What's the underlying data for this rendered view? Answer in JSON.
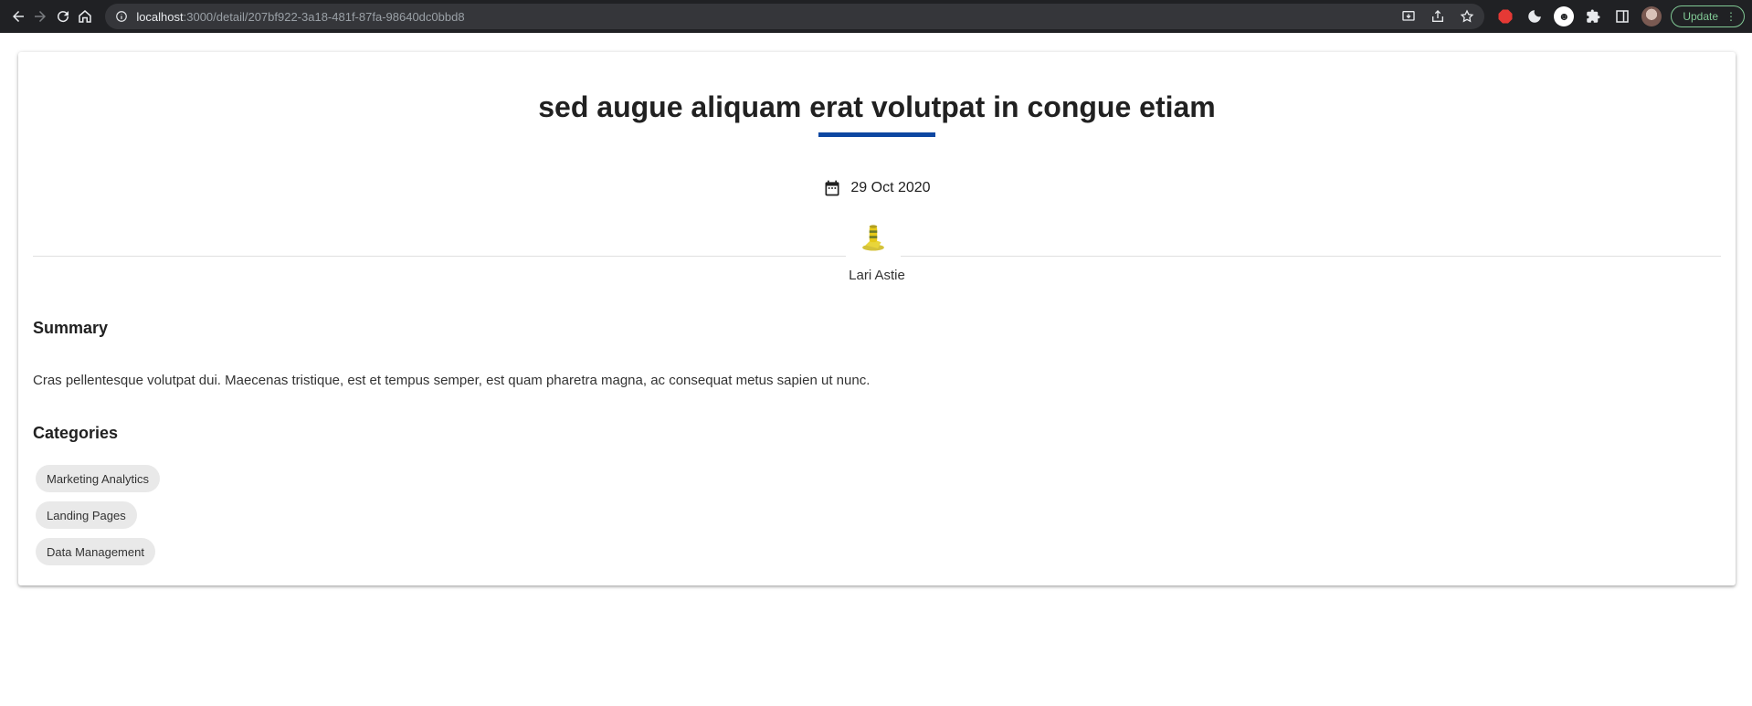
{
  "browser": {
    "url_host": "localhost",
    "url_rest": ":3000/detail/207bf922-3a18-481f-87fa-98640dc0bbd8",
    "update_label": "Update"
  },
  "article": {
    "title": "sed augue aliquam erat volutpat in congue etiam",
    "date": "29 Oct 2020",
    "author": "Lari Astie",
    "summary_heading": "Summary",
    "summary_text": "Cras pellentesque volutpat dui. Maecenas tristique, est et tempus semper, est quam pharetra magna, ac consequat metus sapien ut nunc.",
    "categories_heading": "Categories",
    "categories": [
      "Marketing Analytics",
      "Landing Pages",
      "Data Management"
    ]
  },
  "colors": {
    "accent": "#0d47a1",
    "chip_bg": "#e9e9e9"
  }
}
